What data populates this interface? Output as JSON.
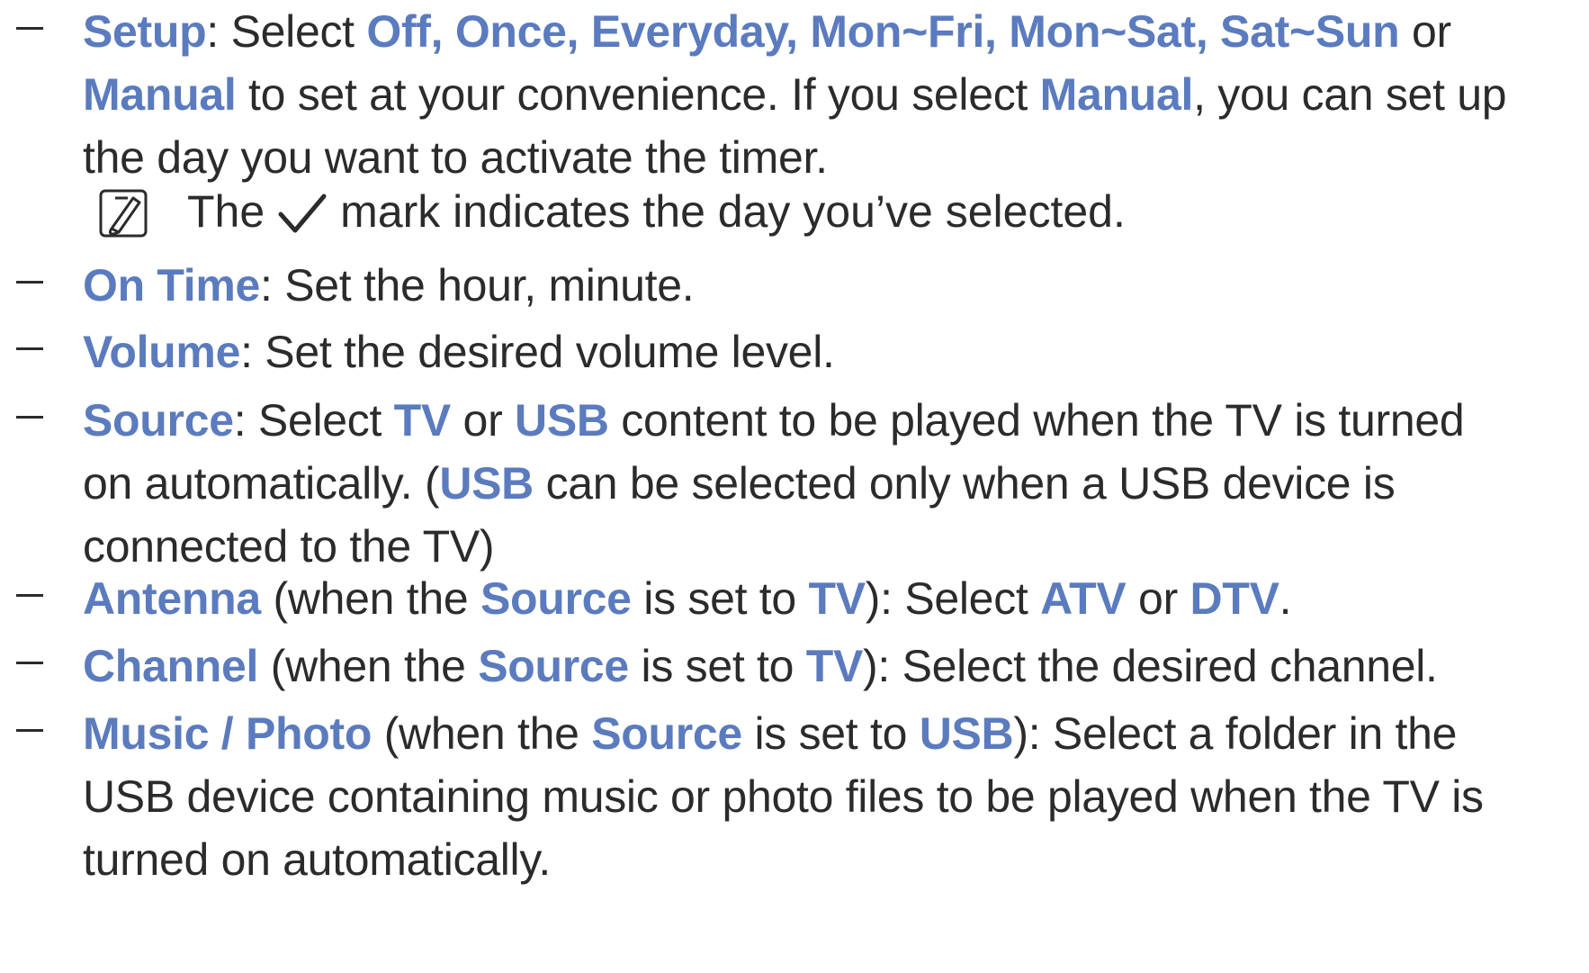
{
  "accent_color": "#5b7bbf",
  "text_color": "#2b2b2b",
  "items": {
    "setup": {
      "kw": "Setup",
      "t1": ": Select ",
      "opts": "Off, Once, Everyday, Mon~Fri, Mon~Sat, Sat~Sun",
      "t2": " or",
      "manual": "Manual",
      "t3": " to set at your convenience. If you select ",
      "manual2": "Manual",
      "t4": ", you can set up",
      "t5": "the day you want to activate the timer."
    },
    "note": {
      "icon": "note-icon",
      "t1": "The",
      "check_icon": "check-icon",
      "t2": "mark indicates the day you’ve selected."
    },
    "on_time": {
      "kw": "On Time",
      "t1": ": Set the hour, minute."
    },
    "volume": {
      "kw": "Volume",
      "t1": ": Set the desired volume level."
    },
    "source": {
      "kw": "Source",
      "t1": ": Select ",
      "tv": "TV",
      "t2": " or ",
      "usb": "USB",
      "t3": " content to be played when the TV is turned",
      "t4": "on automatically. (",
      "usb2": "USB",
      "t5": " can be selected only when a USB device is",
      "t6": "connected to the TV)"
    },
    "antenna": {
      "kw": "Antenna",
      "t1": " (when the ",
      "source": "Source",
      "t2": " is set to ",
      "tv": "TV",
      "t3": "): Select ",
      "atv": "ATV",
      "t4": " or ",
      "dtv": "DTV",
      "t5": "."
    },
    "channel": {
      "kw": "Channel",
      "t1": " (when the ",
      "source": "Source",
      "t2": " is set to ",
      "tv": "TV",
      "t3": "): Select the desired channel."
    },
    "music_photo": {
      "kw": "Music / Photo",
      "t1": " (when the ",
      "source": "Source",
      "t2": " is set to ",
      "usb": "USB",
      "t3": "): Select a folder in the",
      "t4": "USB device containing music or photo files to be played when the TV is",
      "t5": "turned on automatically."
    }
  }
}
